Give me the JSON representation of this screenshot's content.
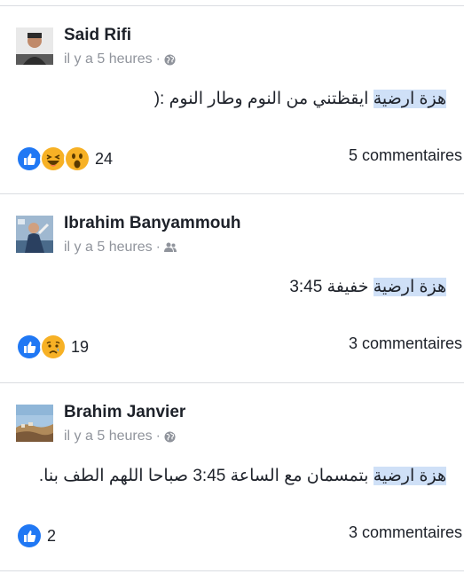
{
  "posts": [
    {
      "author": "Said Rifi",
      "time": "il y a 5 heures",
      "privacy_icon": "globe-icon",
      "highlight": "هزة ارضية",
      "text_rest": " ايقظتني من النوم وطار النوم :(",
      "reactions": [
        "like-icon",
        "haha-icon",
        "wow-icon"
      ],
      "reaction_count": "24",
      "comments": "5 commentaires"
    },
    {
      "author": "Ibrahim Banyammouh",
      "time": "il y a 5 heures",
      "privacy_icon": "friends-icon",
      "highlight": "هزة ارضية",
      "text_rest": " خفيفة 3:45",
      "reactions": [
        "like-icon",
        "sad-icon"
      ],
      "reaction_count": "19",
      "comments": "3 commentaires"
    },
    {
      "author": "Brahim Janvier",
      "time": "il y a 5 heures",
      "privacy_icon": "globe-icon",
      "highlight": "هزة ارضية",
      "text_rest": " بتمسمان مع الساعة 3:45 صباحا اللهم الطف بنا.",
      "reactions": [
        "like-icon"
      ],
      "reaction_count": "2",
      "comments": "3 commentaires"
    }
  ],
  "colors": {
    "like_blue": "#2078f4",
    "reaction_yellow": "#f7b125",
    "highlight": "#cfe0f7",
    "meta_gray": "#90949c",
    "divider": "#dadde1"
  }
}
